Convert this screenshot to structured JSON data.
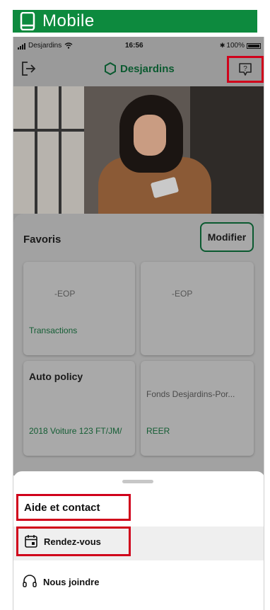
{
  "banner": {
    "title": "Mobile",
    "icon": "smartphone-icon"
  },
  "status_bar": {
    "carrier": "Desjardins",
    "time": "16:56",
    "battery": "100%"
  },
  "header": {
    "brand": "Desjardins",
    "logout_icon": "logout-icon",
    "help_icon": "help-chat-icon"
  },
  "favorites": {
    "title": "Favoris",
    "modify_label": "Modifier",
    "cards": [
      {
        "code": "-EOP",
        "link": "Transactions"
      },
      {
        "code": "-EOP",
        "link": ""
      },
      {
        "name": "Auto policy",
        "link": "2018 Voiture 123 FT/JM/"
      },
      {
        "desc": "Fonds Desjardins-Por...",
        "link": "REER"
      }
    ]
  },
  "sheet": {
    "title": "Aide et contact",
    "items": [
      {
        "label": "Rendez-vous",
        "icon": "calendar-icon"
      },
      {
        "label": "Nous joindre",
        "icon": "headset-icon"
      }
    ]
  },
  "colors": {
    "banner": "#0d8a3e",
    "brand": "#0b5a30",
    "highlight": "#d0021b",
    "overlay": "#9a9a9a"
  }
}
